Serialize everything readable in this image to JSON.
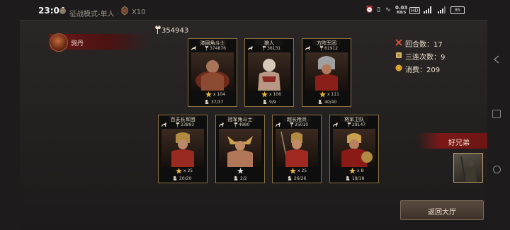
{
  "status_bar": {
    "time": "23:04",
    "mode": "征战模式-单人 ·",
    "ticket": "X10",
    "network_speed_top": "0.03",
    "network_speed_unit": "KB/S",
    "hd": "HD",
    "battery": "85"
  },
  "player": {
    "name": "驹丹"
  },
  "power_total": "354943",
  "stats": {
    "rounds": "回合数：17",
    "streak": "三连次数：9",
    "cost": "消费：209"
  },
  "cards": [
    {
      "name": "漆网角斗士",
      "power": "374876",
      "count": "x 104",
      "troops": "37/37"
    },
    {
      "name": "狼人",
      "power": "36131",
      "count": "x 106",
      "troops": "9/9"
    },
    {
      "name": "方阵军团",
      "power": "61912",
      "count": "x 111",
      "troops": "40/40"
    },
    {
      "name": "百夫长军团",
      "power": "23893",
      "count": "x 25",
      "troops": "20/20"
    },
    {
      "name": "冠军角斗士",
      "power": "4980",
      "count": "",
      "troops": "2/2"
    },
    {
      "name": "超长枪兵",
      "power": "25010",
      "count": "x 25",
      "troops": "26/26"
    },
    {
      "name": "将军卫队",
      "power": "28147",
      "count": "x 8",
      "troops": "18/18"
    }
  ],
  "friend": {
    "label": "好兄弟"
  },
  "return_button": {
    "label": "返回大厅"
  },
  "icons": [
    "mode-icon",
    "ticket-icon",
    "alarm-icon",
    "vibrate-icon",
    "wifi-icon",
    "signal-icon",
    "power-icon",
    "crossed-swords-icon",
    "scroll-icon",
    "coin-icon",
    "horse-icon",
    "star-icon",
    "troops-icon",
    "back-nav-icon",
    "home-nav-icon",
    "recent-nav-icon"
  ],
  "colors": {
    "accent_red": "#7d1818",
    "card_border": "#8a7040",
    "gold": "#e8b43a"
  }
}
